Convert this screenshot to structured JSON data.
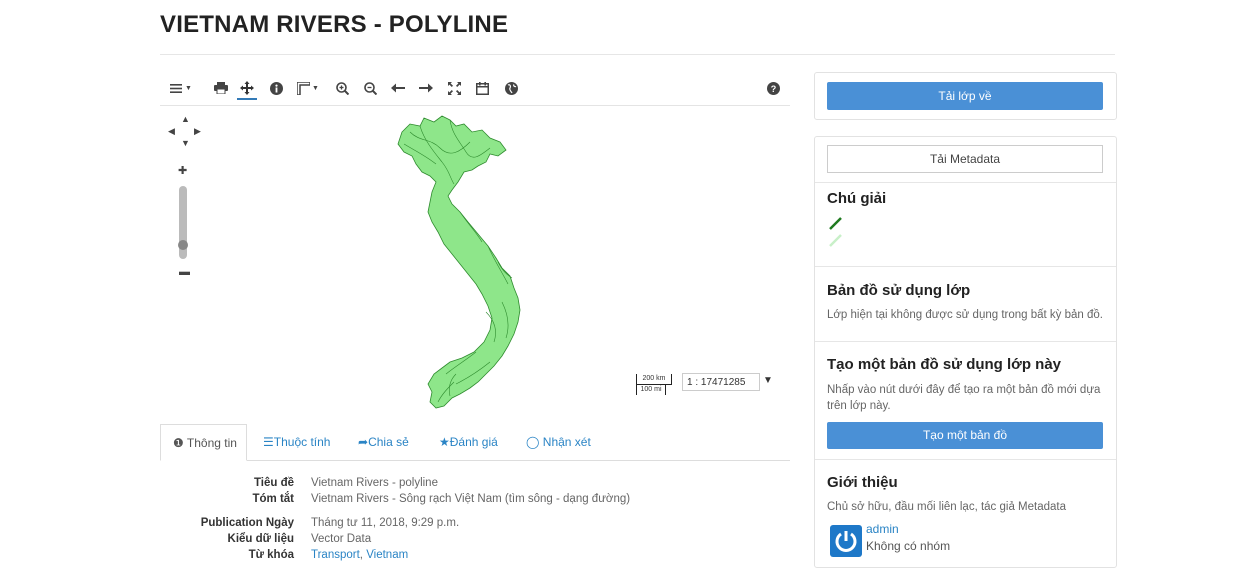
{
  "page": {
    "title": "VIETNAM RIVERS - POLYLINE"
  },
  "map": {
    "scale_top": "200 km",
    "scale_bottom": "100 mi",
    "scale_value": "1 : 17471285"
  },
  "tabs": [
    {
      "label": "Thông tin",
      "icon": "info-circle-icon"
    },
    {
      "label": "Thuộc tính",
      "icon": "list-icon"
    },
    {
      "label": "Chia sẻ",
      "icon": "share-icon"
    },
    {
      "label": "Đánh giá",
      "icon": "star-icon"
    },
    {
      "label": "Nhận xét",
      "icon": "comment-icon"
    }
  ],
  "info": {
    "rows": [
      {
        "label": "Tiêu đề",
        "value": "Vietnam Rivers - polyline"
      },
      {
        "label": "Tóm tắt",
        "value": "Vietnam Rivers - Sông rạch Việt Nam (tìm sông - dạng đường)"
      },
      {
        "label": "Publication Ngày",
        "value": "Tháng tư 11, 2018, 9:29 p.m."
      },
      {
        "label": "Kiểu dữ liệu",
        "value": "Vector Data"
      },
      {
        "label": "Từ khóa",
        "value_links": [
          "Transport",
          "Vietnam"
        ]
      }
    ]
  },
  "sidebar": {
    "download_layer": "Tải lớp về",
    "download_metadata": "Tải Metadata",
    "legend_title": "Chú giải",
    "maps_using_title": "Bản đồ sử dụng lớp",
    "maps_using_text": "Lớp hiện tại không được sử dụng trong bất kỳ bản đồ.",
    "create_map_title": "Tạo một bản đồ sử dụng lớp này",
    "create_map_text": "Nhấp vào nút dưới đây để tạo ra một bản đồ mới dựa trên lớp này.",
    "create_map_button": "Tạo một bản đồ",
    "about_title": "Giới thiệu",
    "about_text": "Chủ sở hữu, đầu mối liên lạc, tác giả Metadata",
    "owner_name": "admin",
    "owner_group": "Không có nhóm"
  },
  "colors": {
    "primary": "#4a90d6",
    "link": "#2a84c5",
    "map_fill": "#8ee68a",
    "map_stroke": "#2e8b2e",
    "legend_dark": "#1f7a1f",
    "legend_light": "#c8f0c8"
  }
}
